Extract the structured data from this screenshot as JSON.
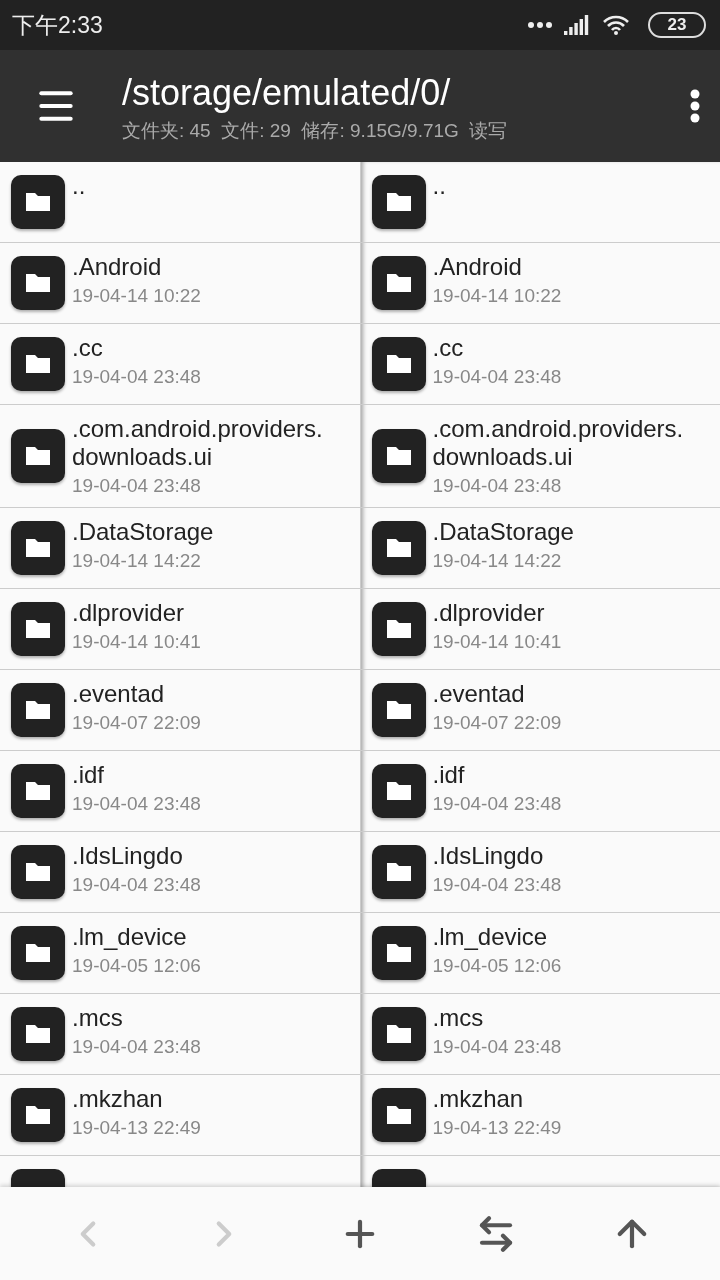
{
  "status_bar": {
    "time": "下午2:33",
    "battery": "23"
  },
  "toolbar": {
    "path": "/storage/emulated/0/",
    "info": "文件夹: 45  文件: 29  储存: 9.15G/9.71G  读写"
  },
  "panes": [
    {
      "items": [
        {
          "name": ".."
        },
        {
          "name": ".Android",
          "date": "19-04-14 10:22"
        },
        {
          "name": ".cc",
          "date": "19-04-04 23:48"
        },
        {
          "name": ".com.android.providers.downloads.ui",
          "date": "19-04-04 23:48"
        },
        {
          "name": ".DataStorage",
          "date": "19-04-14 14:22"
        },
        {
          "name": ".dlprovider",
          "date": "19-04-14 10:41"
        },
        {
          "name": ".eventad",
          "date": "19-04-07 22:09"
        },
        {
          "name": ".idf",
          "date": "19-04-04 23:48"
        },
        {
          "name": ".IdsLingdo",
          "date": "19-04-04 23:48"
        },
        {
          "name": ".lm_device",
          "date": "19-04-05 12:06"
        },
        {
          "name": ".mcs",
          "date": "19-04-04 23:48"
        },
        {
          "name": ".mkzhan",
          "date": "19-04-13 22:49"
        }
      ]
    },
    {
      "items": [
        {
          "name": ".."
        },
        {
          "name": ".Android",
          "date": "19-04-14 10:22"
        },
        {
          "name": ".cc",
          "date": "19-04-04 23:48"
        },
        {
          "name": ".com.android.providers.downloads.ui",
          "date": "19-04-04 23:48"
        },
        {
          "name": ".DataStorage",
          "date": "19-04-14 14:22"
        },
        {
          "name": ".dlprovider",
          "date": "19-04-14 10:41"
        },
        {
          "name": ".eventad",
          "date": "19-04-07 22:09"
        },
        {
          "name": ".idf",
          "date": "19-04-04 23:48"
        },
        {
          "name": ".IdsLingdo",
          "date": "19-04-04 23:48"
        },
        {
          "name": ".lm_device",
          "date": "19-04-05 12:06"
        },
        {
          "name": ".mcs",
          "date": "19-04-04 23:48"
        },
        {
          "name": ".mkzhan",
          "date": "19-04-13 22:49"
        }
      ]
    }
  ],
  "bottom_bar": [
    {
      "kind": "back",
      "disabled": true
    },
    {
      "kind": "forward",
      "disabled": true
    },
    {
      "kind": "add",
      "disabled": false
    },
    {
      "kind": "swap",
      "disabled": false
    },
    {
      "kind": "up",
      "disabled": false
    }
  ]
}
